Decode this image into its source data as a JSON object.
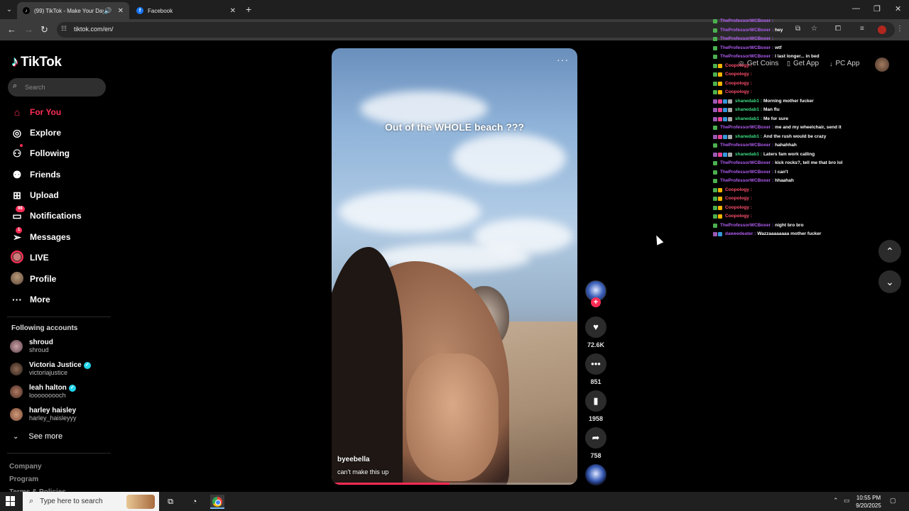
{
  "browser": {
    "tabs": [
      {
        "title": "(99) TikTok - Make Your Day",
        "active": true
      },
      {
        "title": "Facebook",
        "active": false
      }
    ],
    "url": "tiktok.com/en/"
  },
  "sidebar": {
    "logo": "TikTok",
    "search_placeholder": "Search",
    "nav": [
      {
        "label": "For You",
        "icon": "home-icon"
      },
      {
        "label": "Explore",
        "icon": "compass-icon"
      },
      {
        "label": "Following",
        "icon": "following-icon"
      },
      {
        "label": "Friends",
        "icon": "friends-icon"
      },
      {
        "label": "Upload",
        "icon": "upload-icon"
      },
      {
        "label": "Notifications",
        "icon": "inbox-icon",
        "badge": "98"
      },
      {
        "label": "Messages",
        "icon": "send-icon",
        "badge": "1"
      },
      {
        "label": "LIVE",
        "icon": "live-avatar"
      },
      {
        "label": "Profile",
        "icon": "profile-avatar"
      },
      {
        "label": "More",
        "icon": "more-icon"
      }
    ],
    "following_title": "Following accounts",
    "following": [
      {
        "name": "shroud",
        "handle": "shroud",
        "verified": false
      },
      {
        "name": "Victoria Justice",
        "handle": "victoriajustice",
        "verified": true
      },
      {
        "name": "leah halton",
        "handle": "looooooooch",
        "verified": true
      },
      {
        "name": "harley haisley",
        "handle": "harley_haisleyyy",
        "verified": false
      }
    ],
    "see_more": "See more",
    "footer": [
      "Company",
      "Program",
      "Terms & Policies"
    ]
  },
  "header": {
    "get_coins": "Get Coins",
    "get_app": "Get App",
    "pc_app": "PC App"
  },
  "video": {
    "overlay_text": "Out of the WHOLE beach ???",
    "author": "byeebella",
    "caption": "can't make this up",
    "progress": 0.48
  },
  "actions": {
    "likes": "72.6K",
    "comments": "851",
    "saves": "1958",
    "shares": "758"
  },
  "chat": [
    {
      "user": "TheProfessorWCBoxer",
      "msg": "",
      "color": "#b05cf0",
      "badges": [
        "#4caf50"
      ]
    },
    {
      "user": "TheProfessorWCBoxer",
      "msg": "hey",
      "color": "#b05cf0",
      "badges": [
        "#4caf50"
      ]
    },
    {
      "user": "TheProfessorWCBoxer",
      "msg": "",
      "color": "#b05cf0",
      "badges": [
        "#4caf50"
      ]
    },
    {
      "user": "TheProfessorWCBoxer",
      "msg": "wtf",
      "color": "#b05cf0",
      "badges": [
        "#4caf50"
      ]
    },
    {
      "user": "TheProfessorWCBoxer",
      "msg": "I last longer... in bed",
      "color": "#b05cf0",
      "badges": [
        "#4caf50"
      ]
    },
    {
      "user": "Coopology",
      "msg": "",
      "color": "#ff4f6d",
      "badges": [
        "#4caf50",
        "#f5b400"
      ]
    },
    {
      "user": "Coopology",
      "msg": "",
      "color": "#ff4f6d",
      "badges": [
        "#4caf50",
        "#f5b400"
      ]
    },
    {
      "user": "Coopology",
      "msg": "",
      "color": "#ff4f6d",
      "badges": [
        "#4caf50",
        "#f5b400"
      ]
    },
    {
      "user": "Coopology",
      "msg": "",
      "color": "#ff4f6d",
      "badges": [
        "#4caf50",
        "#f5b400"
      ]
    },
    {
      "user": "shanedab1",
      "msg": "Morning mother fucker",
      "color": "#3ddc84",
      "badges": [
        "#9b59b6",
        "#e84393",
        "#3498db",
        "#aaa"
      ]
    },
    {
      "user": "shanedab1",
      "msg": "Man flu",
      "color": "#3ddc84",
      "badges": [
        "#9b59b6",
        "#e84393",
        "#3498db",
        "#aaa"
      ]
    },
    {
      "user": "shanedab1",
      "msg": "Me for sure",
      "color": "#3ddc84",
      "badges": [
        "#9b59b6",
        "#e84393",
        "#3498db",
        "#aaa"
      ]
    },
    {
      "user": "TheProfessorWCBoxer",
      "msg": "me and my wheelchair, send it",
      "color": "#b05cf0",
      "badges": [
        "#4caf50"
      ]
    },
    {
      "user": "shanedab1",
      "msg": "And the rush would be crazy",
      "color": "#3ddc84",
      "badges": [
        "#9b59b6",
        "#e84393",
        "#3498db",
        "#aaa"
      ]
    },
    {
      "user": "TheProfessorWCBoxer",
      "msg": "hahahhah",
      "color": "#b05cf0",
      "badges": [
        "#4caf50"
      ]
    },
    {
      "user": "shanedab1",
      "msg": "Laters fam work calling",
      "color": "#3ddc84",
      "badges": [
        "#9b59b6",
        "#e84393",
        "#3498db",
        "#aaa"
      ]
    },
    {
      "user": "TheProfessorWCBoxer",
      "msg": "kick rocks?, tell me that bro lol",
      "color": "#b05cf0",
      "badges": [
        "#4caf50"
      ]
    },
    {
      "user": "TheProfessorWCBoxer",
      "msg": "I can't",
      "color": "#b05cf0",
      "badges": [
        "#4caf50"
      ]
    },
    {
      "user": "TheProfessorWCBoxer",
      "msg": "hhaahah",
      "color": "#b05cf0",
      "badges": [
        "#4caf50"
      ]
    },
    {
      "user": "Coopology",
      "msg": "",
      "color": "#ff4f6d",
      "badges": [
        "#4caf50",
        "#f5b400"
      ]
    },
    {
      "user": "Coopology",
      "msg": "",
      "color": "#ff4f6d",
      "badges": [
        "#4caf50",
        "#f5b400"
      ]
    },
    {
      "user": "Coopology",
      "msg": "",
      "color": "#ff4f6d",
      "badges": [
        "#4caf50",
        "#f5b400"
      ]
    },
    {
      "user": "Coopology",
      "msg": "",
      "color": "#ff4f6d",
      "badges": [
        "#4caf50",
        "#f5b400"
      ]
    },
    {
      "user": "TheProfessorWCBoxer",
      "msg": "night bro bro",
      "color": "#b05cf0",
      "badges": [
        "#4caf50"
      ]
    },
    {
      "user": "daweedeater",
      "msg": "Wazzaaaaaaaa mother fucker",
      "color": "#b05cf0",
      "badges": [
        "#9b59b6",
        "#3498db"
      ]
    }
  ],
  "taskbar": {
    "search_placeholder": "Type here to search",
    "time": "10:55 PM",
    "date": "9/20/2025"
  },
  "colors": {
    "accent": "#fe2c55",
    "background": "#000000"
  }
}
